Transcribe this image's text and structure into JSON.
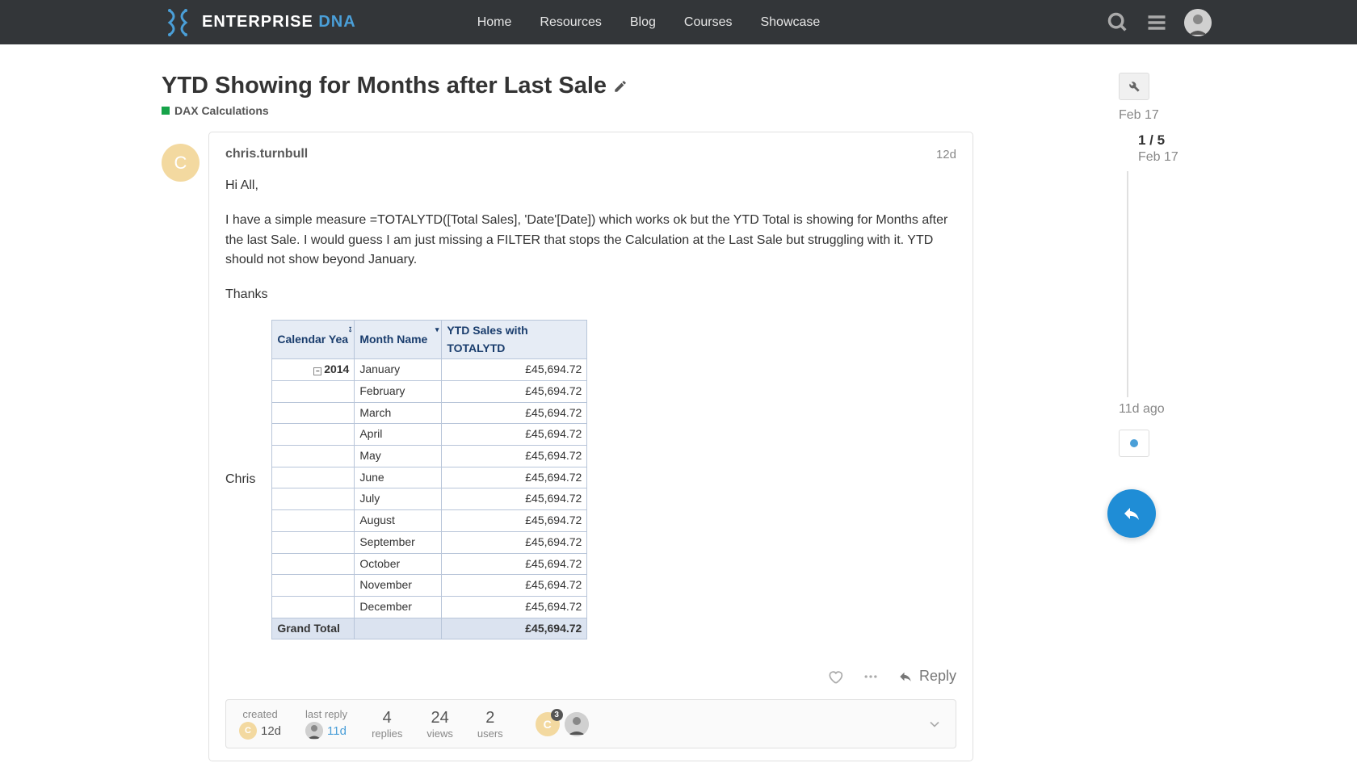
{
  "header": {
    "logo_text_1": "ENTERPRISE ",
    "logo_text_2": "DNA",
    "nav": [
      "Home",
      "Resources",
      "Blog",
      "Courses",
      "Showcase"
    ]
  },
  "topic": {
    "title": "YTD Showing for Months after Last Sale",
    "category": "DAX Calculations"
  },
  "post": {
    "author": "chris.turnbull",
    "avatar_letter": "C",
    "age": "12d",
    "greeting": "Hi All,",
    "body": "I have a simple measure =TOTALYTD([Total Sales], 'Date'[Date]) which works ok but the YTD Total is showing for Months after the last Sale. I would guess I am just missing a FILTER that stops the Calculation at the Last Sale but struggling with it. YTD should not show beyond January.",
    "thanks": "Thanks",
    "signature": "Chris"
  },
  "table": {
    "headers": [
      "Calendar Yea",
      "Month Name",
      "YTD Sales with TOTALYTD"
    ],
    "year": "2014",
    "rows": [
      {
        "month": "January",
        "value": "£45,694.72"
      },
      {
        "month": "February",
        "value": "£45,694.72"
      },
      {
        "month": "March",
        "value": "£45,694.72"
      },
      {
        "month": "April",
        "value": "£45,694.72"
      },
      {
        "month": "May",
        "value": "£45,694.72"
      },
      {
        "month": "June",
        "value": "£45,694.72"
      },
      {
        "month": "July",
        "value": "£45,694.72"
      },
      {
        "month": "August",
        "value": "£45,694.72"
      },
      {
        "month": "September",
        "value": "£45,694.72"
      },
      {
        "month": "October",
        "value": "£45,694.72"
      },
      {
        "month": "November",
        "value": "£45,694.72"
      },
      {
        "month": "December",
        "value": "£45,694.72"
      }
    ],
    "total_label": "Grand Total",
    "total_value": "£45,694.72"
  },
  "actions": {
    "reply": "Reply"
  },
  "stats": {
    "created_label": "created",
    "created_value": "12d",
    "lastreply_label": "last reply",
    "lastreply_value": "11d",
    "replies_n": "4",
    "replies_label": "replies",
    "views_n": "24",
    "views_label": "views",
    "users_n": "2",
    "users_label": "users",
    "badge": "3"
  },
  "timeline": {
    "top_date": "Feb 17",
    "position": "1 / 5",
    "position_date": "Feb 17",
    "ago": "11d ago"
  }
}
